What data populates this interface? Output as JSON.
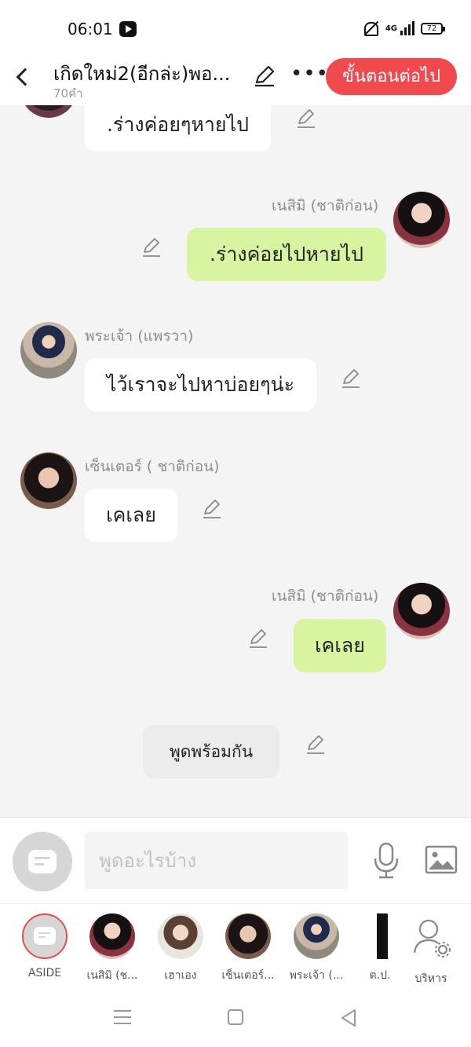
{
  "status_bar": {
    "time": "06:01",
    "network": "4G",
    "battery": "72"
  },
  "header": {
    "title": "เกิดใหม่2(อีกล่ะ)พอ...",
    "word_count": "70คำ",
    "next_button": "ขั้นตอนต่อไป"
  },
  "messages": [
    {
      "side": "left",
      "name": "",
      "text": ".ร่างค่อยๆหายไป"
    },
    {
      "side": "right",
      "name": "เนสิมิ (ชาติก่อน)",
      "text": ".ร่างค่อยไปหายไป"
    },
    {
      "side": "left",
      "name": "พระเจ้า (แพรวา)",
      "text": "ไว้เราจะไปหาบ่อยๆน่ะ"
    },
    {
      "side": "left",
      "name": "เซ็นเตอร์ ( ชาติก่อน)",
      "text": "เคเลย"
    },
    {
      "side": "right",
      "name": "เนสิมิ (ชาติก่อน)",
      "text": "เคเลย"
    },
    {
      "side": "center",
      "name": "",
      "text": "พูดพร้อมกัน"
    }
  ],
  "input": {
    "placeholder": "พูดอะไรบ้าง"
  },
  "characters": [
    {
      "label": "ASIDE"
    },
    {
      "label": "เนสิมิ (ช..."
    },
    {
      "label": "เฮาเอง"
    },
    {
      "label": "เซ็นเตอร์..."
    },
    {
      "label": "พระเจ้า (..."
    },
    {
      "label": "ต.ป."
    },
    {
      "label": "บริหาร"
    }
  ],
  "colors": {
    "accent": "#f04a4e",
    "my_bubble": "#d7f5a0",
    "other_bubble": "#ffffff"
  }
}
